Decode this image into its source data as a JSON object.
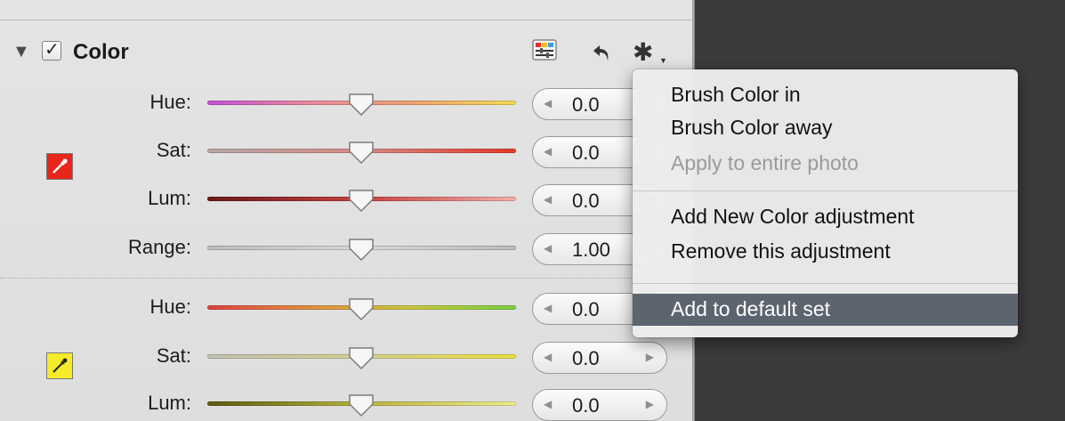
{
  "section": {
    "title": "Color",
    "enabled": true
  },
  "header_icons": [
    "color-picker-icon",
    "reset-arrow-icon",
    "gear-icon"
  ],
  "groups": [
    {
      "swatch_color": "#e8261b",
      "rows": [
        {
          "label": "Hue:",
          "value": "0.0",
          "track": "linear-gradient(90deg,#c44fd8,#e88a9a,#f0a070,#f2dc50)"
        },
        {
          "label": "Sat:",
          "value": "0.0",
          "track": "linear-gradient(90deg,#b7a8a8,#d88a82,#e23a2a)"
        },
        {
          "label": "Lum:",
          "value": "0.0",
          "track": "linear-gradient(90deg,#6a1818,#c84040,#f2b0a8)"
        },
        {
          "label": "Range:",
          "value": "1.00",
          "track": "linear-gradient(90deg,#bdbdbd,#d8d8d8,#bdbdbd)"
        }
      ]
    },
    {
      "swatch_color": "#f4ec2a",
      "rows": [
        {
          "label": "Hue:",
          "value": "0.0",
          "track": "linear-gradient(90deg,#e04040,#e09040,#c8c840,#7ad040)"
        },
        {
          "label": "Sat:",
          "value": "0.0",
          "track": "linear-gradient(90deg,#c4c2b4,#d4d090,#ece040)"
        },
        {
          "label": "Lum:",
          "value": "0.0",
          "track": "linear-gradient(90deg,#5c5a10,#b8b440,#f0ec90)"
        }
      ]
    }
  ],
  "menu": {
    "items": [
      {
        "label": "Brush Color in",
        "disabled": false,
        "selected": false
      },
      {
        "label": "Brush Color away",
        "disabled": false,
        "selected": false
      },
      {
        "label": "Apply to entire photo",
        "disabled": true,
        "selected": false
      },
      {
        "label": "Add New Color adjustment",
        "disabled": false,
        "selected": false
      },
      {
        "label": "Remove this adjustment",
        "disabled": false,
        "selected": false
      },
      {
        "label": "Add to default set",
        "disabled": false,
        "selected": true
      }
    ]
  }
}
